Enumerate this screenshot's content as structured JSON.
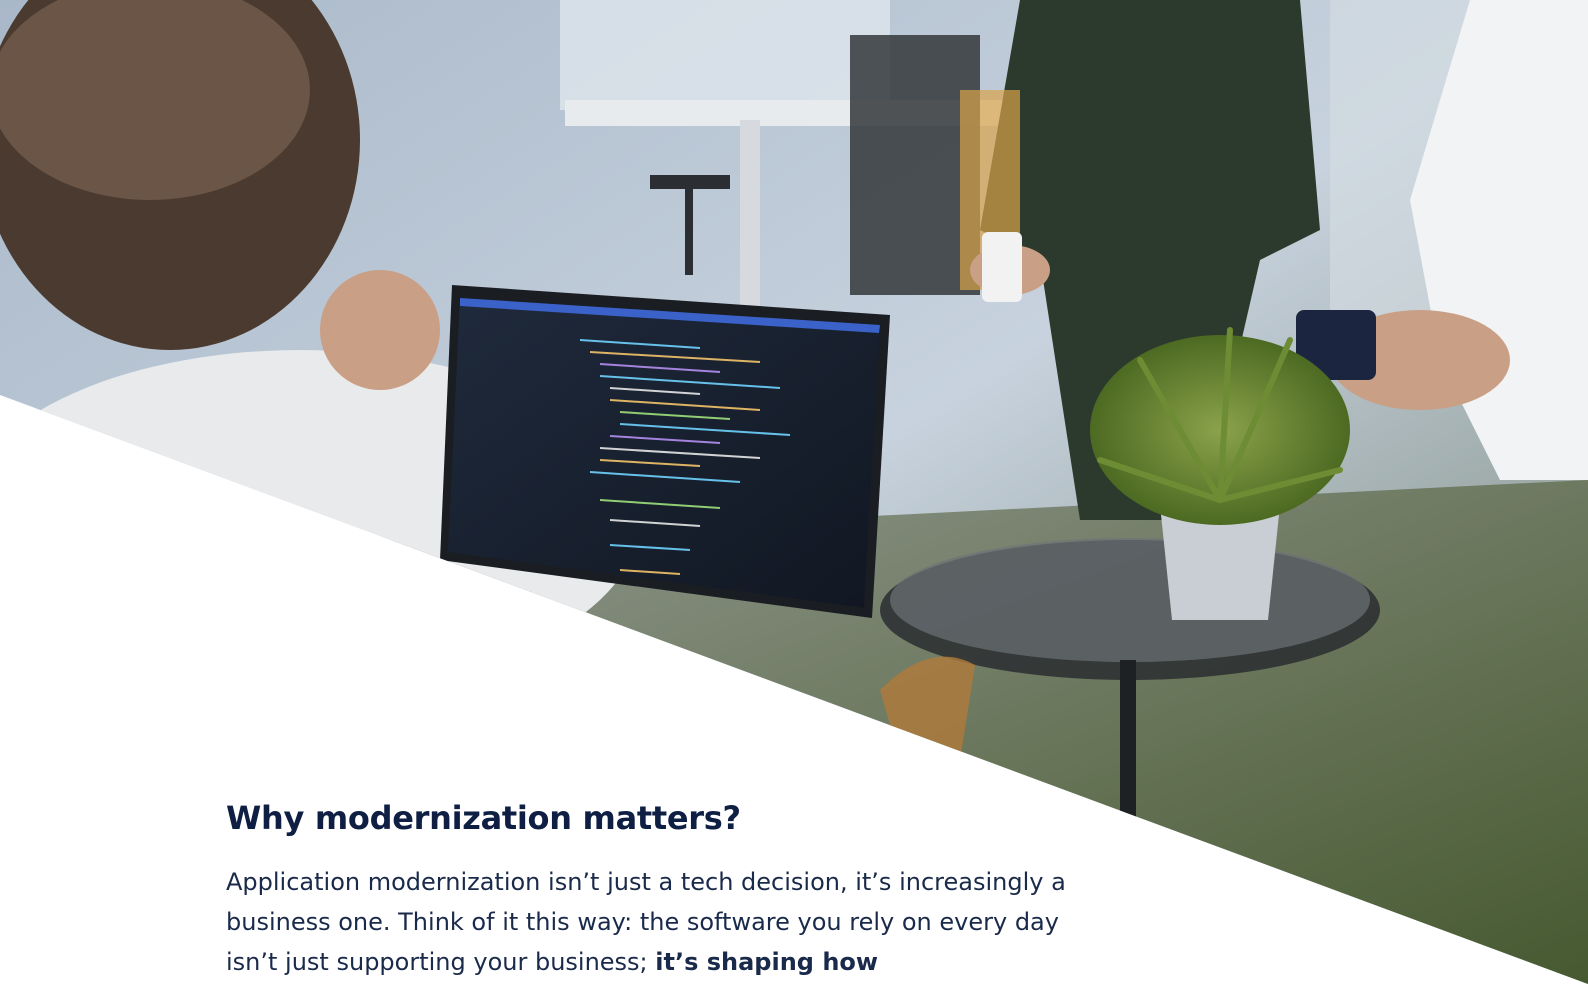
{
  "hero_image": {
    "description_icon": "office-photo"
  },
  "section": {
    "heading": "Why modernization matters?",
    "paragraph_lead": "Application modernization isn’t just a tech decision, it’s increasingly a business one. Think of it this way: the software you rely on every day isn’t just supporting your business; ",
    "paragraph_emphasis": "it’s shaping how"
  },
  "colors": {
    "heading": "#0f1f44",
    "body": "#1a2a4a",
    "background": "#ffffff"
  }
}
